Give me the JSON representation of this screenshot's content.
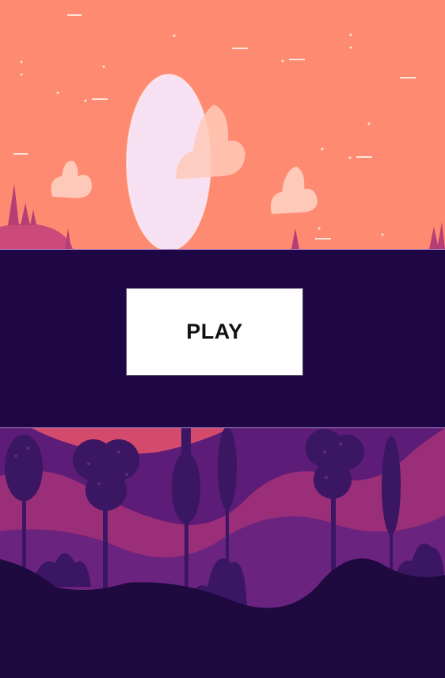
{
  "game": {
    "play_label": "PLAY"
  },
  "colors": {
    "sky": "#ff8a72",
    "moon": "#f6e0f2",
    "cloud": "#ffc9b9",
    "band": "#1f0645",
    "button_bg": "#ffffff",
    "forest_dark": "#1f0a3f",
    "forest_mid": "#3a1663",
    "forest_purple": "#5c1c77",
    "forest_pink": "#b2366e"
  },
  "icons": {
    "moon": "moon-icon",
    "cloud": "cloud-icon",
    "star": "sparkle-icon",
    "tree": "tree-icon"
  }
}
